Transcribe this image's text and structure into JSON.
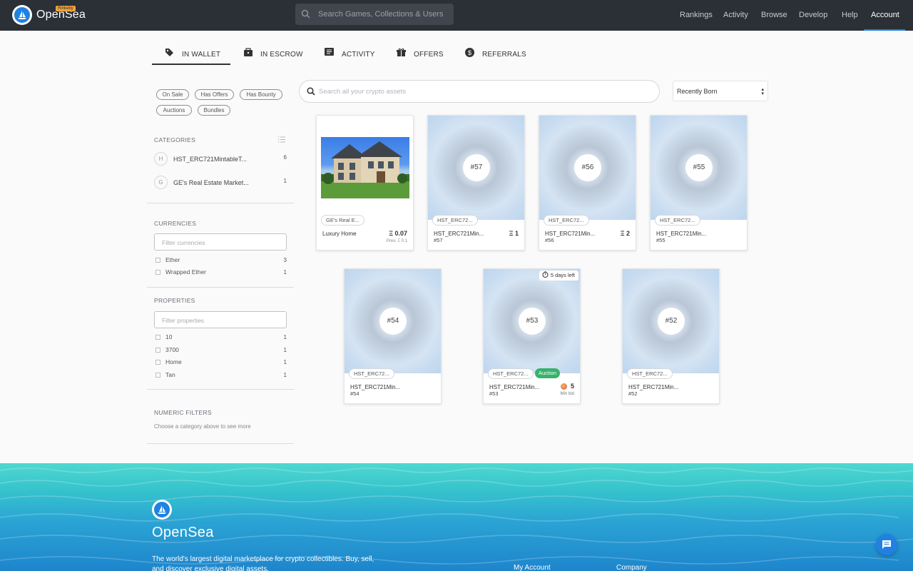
{
  "colors": {
    "nav_bg": "#2b2f36",
    "accent": "#2081e2",
    "auction": "#37b26c",
    "badge": "#f2a33a"
  },
  "nav": {
    "brand": "OpenSea",
    "badge": "Rinkeby",
    "search_placeholder": "Search Games, Collections & Users",
    "links": [
      "Rankings",
      "Activity",
      "Browse",
      "Develop",
      "Help",
      "Account"
    ],
    "active": "Account"
  },
  "tabs": [
    {
      "label": "IN WALLET",
      "icon": "tag-icon"
    },
    {
      "label": "IN ESCROW",
      "icon": "briefcase-icon"
    },
    {
      "label": "ACTIVITY",
      "icon": "activity-icon"
    },
    {
      "label": "OFFERS",
      "icon": "gift-icon"
    },
    {
      "label": "REFERRALS",
      "icon": "dollar-icon"
    }
  ],
  "filters": {
    "pills": [
      "On Sale",
      "Has Offers",
      "Has Bounty",
      "Auctions",
      "Bundles"
    ]
  },
  "categories": {
    "heading": "CATEGORIES",
    "items": [
      {
        "initial": "H",
        "name": "HST_ERC721MintableT...",
        "count": "6"
      },
      {
        "initial": "G",
        "name": "GE's Real Estate Market...",
        "count": "1"
      }
    ]
  },
  "currencies": {
    "heading": "CURRENCIES",
    "placeholder": "Filter currencies",
    "items": [
      {
        "label": "Ether",
        "count": "3"
      },
      {
        "label": "Wrapped Ether",
        "count": "1"
      }
    ]
  },
  "properties": {
    "heading": "PROPERTIES",
    "placeholder": "Filter properties",
    "items": [
      {
        "label": "10",
        "count": "1"
      },
      {
        "label": "3700",
        "count": "1"
      },
      {
        "label": "Home",
        "count": "1"
      },
      {
        "label": "Tan",
        "count": "1"
      }
    ]
  },
  "numeric": {
    "heading": "NUMERIC FILTERS",
    "note": "Choose a category above to see more"
  },
  "main": {
    "search_placeholder": "Search all your crypto assets",
    "sort": "Recently Born"
  },
  "cards": [
    {
      "collection": "GE's Real E...",
      "name": "Luxury Home",
      "sub": "",
      "price": "Ξ 0.07",
      "prev": "Prev. Ξ 0.1",
      "num": ""
    },
    {
      "collection": "HST_ERC72...",
      "name": "HST_ERC721Min...",
      "sub": "#57",
      "price": "Ξ 1",
      "num": "#57"
    },
    {
      "collection": "HST_ERC72...",
      "name": "HST_ERC721Min...",
      "sub": "#56",
      "price": "Ξ 2",
      "num": "#56"
    },
    {
      "collection": "HST_ERC72...",
      "name": "HST_ERC721Min...",
      "sub": "#55",
      "price": "",
      "num": "#55"
    },
    {
      "collection": "HST_ERC72...",
      "name": "HST_ERC721Min...",
      "sub": "#54",
      "price": "",
      "num": "#54"
    },
    {
      "collection": "HST_ERC72...",
      "name": "HST_ERC721Min...",
      "sub": "#53",
      "num": "#53",
      "auction": "Auction",
      "timer": "5 days left",
      "bid": "5",
      "bid_label": "Min bid"
    },
    {
      "collection": "HST_ERC72...",
      "name": "HST_ERC721Min...",
      "sub": "#52",
      "price": "",
      "num": "#52"
    }
  ],
  "footer": {
    "brand": "OpenSea",
    "tagline": "The world's largest digital marketplace for crypto collectibles. Buy, sell, and discover exclusive digital assets.",
    "columns": [
      "My Account",
      "Company"
    ]
  }
}
